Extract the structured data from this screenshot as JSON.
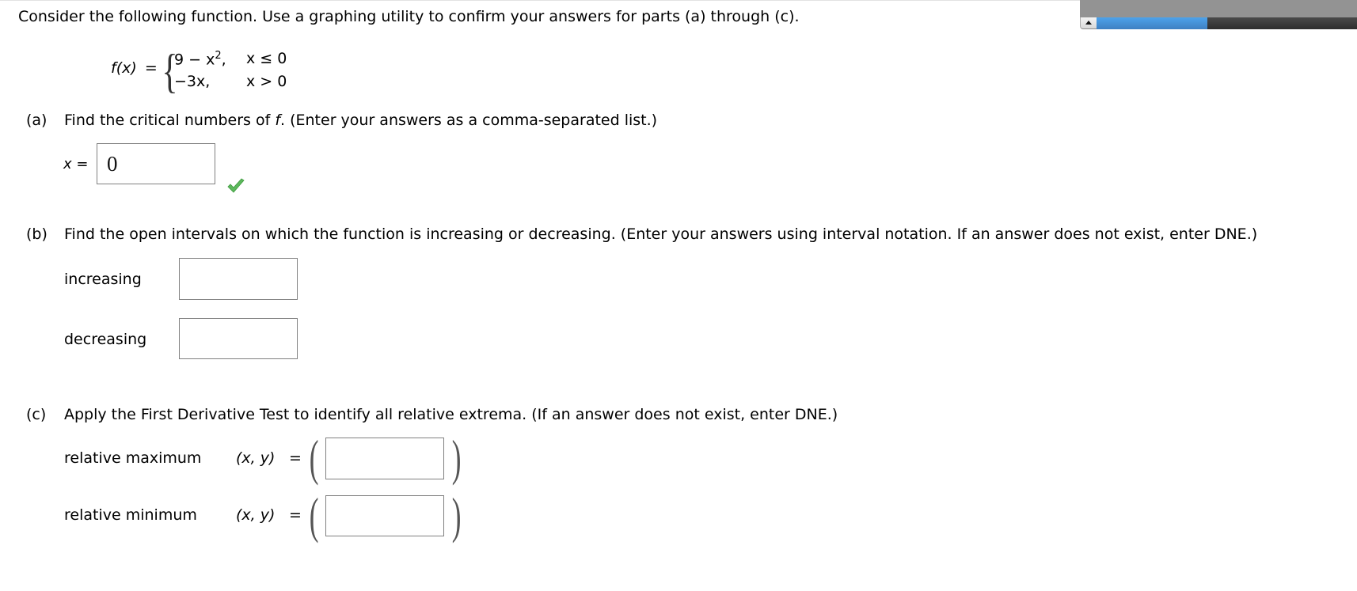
{
  "colors": {
    "checkmark": "#5cb85c",
    "box_border": "#808080",
    "progress_blue": "#4a94dc",
    "progress_dark": "#333333",
    "top_bar_grey": "#939393"
  },
  "top_widget": {
    "collapse_icon": "triangle-up-icon"
  },
  "intro": "Consider the following function. Use a graphing utility to confirm your answers for parts (a) through (c).",
  "function": {
    "lhs": "f(x)",
    "equals": "=",
    "pieces": [
      {
        "expr_base": "9 − x",
        "expr_exp": "2",
        "expr_tail": ",",
        "condition": "x ≤ 0"
      },
      {
        "expr_base": "−3x,",
        "expr_exp": "",
        "expr_tail": "",
        "condition": "x > 0"
      }
    ]
  },
  "part_a": {
    "label": "(a)",
    "prompt_before": "Find the critical numbers of ",
    "prompt_var": "f",
    "prompt_after": ". (Enter your answers as a comma-separated list.)",
    "answer_label": "x =",
    "answer_value": "0",
    "status": "correct",
    "status_icon": "checkmark-icon"
  },
  "part_b": {
    "label": "(b)",
    "prompt": "Find the open intervals on which the function is increasing or decreasing. (Enter your answers using interval notation. If an answer does not exist, enter DNE.)",
    "fields": [
      {
        "label": "increasing",
        "value": ""
      },
      {
        "label": "decreasing",
        "value": ""
      }
    ]
  },
  "part_c": {
    "label": "(c)",
    "prompt": "Apply the First Derivative Test to identify all relative extrema. (If an answer does not exist, enter DNE.)",
    "coord_label": "(x, y)",
    "equals": "=",
    "open_paren": "(",
    "close_paren": ")",
    "fields": [
      {
        "label": "relative maximum",
        "value": ""
      },
      {
        "label": "relative minimum",
        "value": ""
      }
    ]
  }
}
